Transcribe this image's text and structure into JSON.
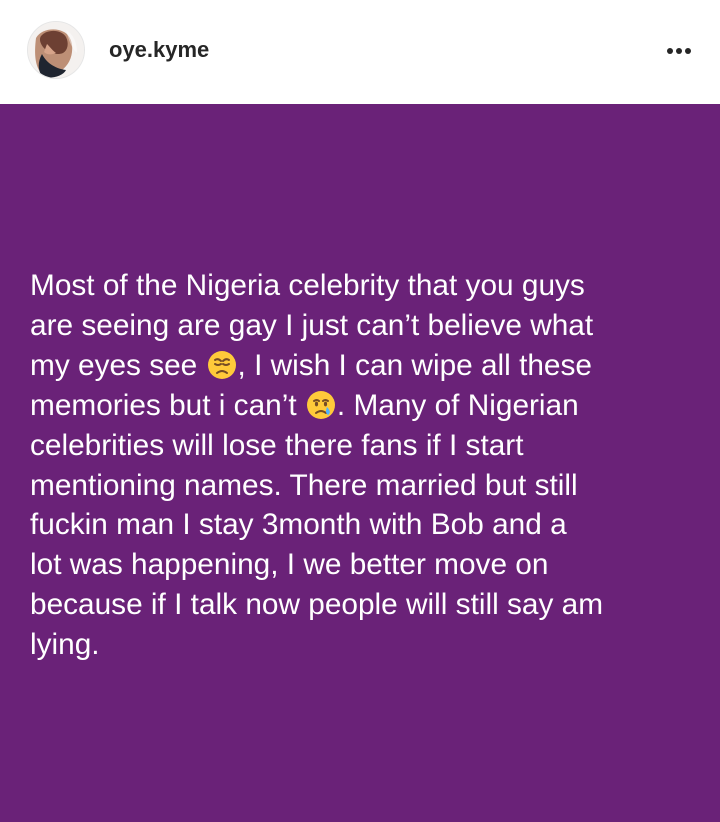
{
  "post": {
    "username": "oye.kyme",
    "icons": {
      "avatar": "profile-photo",
      "more": "more-options-icon"
    },
    "text_segments": [
      "Most of the Nigeria celebrity that you guys\nare seeing are gay I just can’t believe what\nmy eyes see ",
      ", I wish I can wipe all these\nmemories but i can’t ",
      ". Many of Nigerian\ncelebrities will lose there fans if I start\nmentioning names. There married but still\nfuckin man I stay 3month with Bob and a\nlot was happening, I we better move on\nbecause if I talk now people will still say am\nlying."
    ],
    "emojis": [
      "disappointed-face-emoji",
      "crying-face-emoji"
    ],
    "colors": {
      "background": "#6a2278",
      "text": "#ffffff",
      "header_background": "#ffffff",
      "username": "#262626"
    }
  }
}
